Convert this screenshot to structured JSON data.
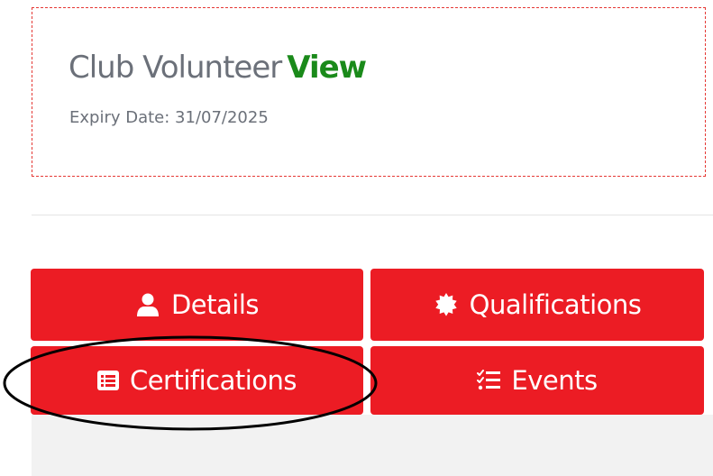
{
  "membership": {
    "title": "Club Volunteer",
    "view_link": "View",
    "expiry": "Expiry Date: 31/07/2025"
  },
  "nav": {
    "details": {
      "label": "Details",
      "icon": "user-icon"
    },
    "qualifications": {
      "label": "Qualifications",
      "icon": "badge-icon"
    },
    "certifications": {
      "label": "Certifications",
      "icon": "list-alt-icon"
    },
    "events": {
      "label": "Events",
      "icon": "tasks-icon"
    }
  },
  "colors": {
    "accent_red": "#ec1c24",
    "view_green": "#1a8a1a",
    "text_grey": "#6b7079",
    "annotation": "#000000"
  }
}
